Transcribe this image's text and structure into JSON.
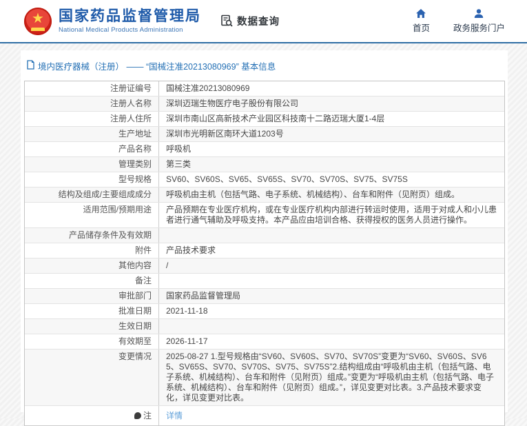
{
  "header": {
    "org_title_cn": "国家药品监督管理局",
    "org_title_en": "National Medical Products Administration",
    "data_query_label": "数据查询",
    "nav": {
      "home_label": "首页",
      "portal_label": "政务服务门户"
    }
  },
  "breadcrumb": {
    "text": "境内医疗器械（注册） —— “国械注准20213080969” 基本信息"
  },
  "colors": {
    "brand_blue": "#1e5aa9",
    "header_border_blue": "#2e6da4",
    "breadcrumb_blue": "#2470b5",
    "link_blue": "#5e9fd9",
    "row_stripe": "#f7f7f7"
  },
  "table": {
    "rows": [
      {
        "label": "注册证编号",
        "value": "国械注准20213080969"
      },
      {
        "label": "注册人名称",
        "value": "深圳迈瑞生物医疗电子股份有限公司"
      },
      {
        "label": "注册人住所",
        "value": "深圳市南山区高新技术产业园区科技南十二路迈瑞大厦1-4层"
      },
      {
        "label": "生产地址",
        "value": "深圳市光明新区南环大道1203号"
      },
      {
        "label": "产品名称",
        "value": "呼吸机"
      },
      {
        "label": "管理类别",
        "value": "第三类"
      },
      {
        "label": "型号规格",
        "value": "SV60、SV60S、SV65、SV65S、SV70、SV70S、SV75、SV75S"
      },
      {
        "label": "结构及组成/主要组成成分",
        "value": "呼吸机由主机（包括气路、电子系统、机械结构）、台车和附件（见附页）组成。"
      },
      {
        "label": "适用范围/预期用途",
        "value": "产品预期在专业医疗机构，或在专业医疗机构内部进行转运时使用，适用于对成人和小儿患者进行通气辅助及呼吸支持。本产品应由培训合格、获得授权的医务人员进行操作。"
      },
      {
        "label": "产品储存条件及有效期",
        "value": ""
      },
      {
        "label": "附件",
        "value": "产品技术要求"
      },
      {
        "label": "其他内容",
        "value": "/"
      },
      {
        "label": "备注",
        "value": ""
      },
      {
        "label": "审批部门",
        "value": "国家药品监督管理局"
      },
      {
        "label": "批准日期",
        "value": "2021-11-18"
      },
      {
        "label": "生效日期",
        "value": ""
      },
      {
        "label": "有效期至",
        "value": "2026-11-17"
      },
      {
        "label": "变更情况",
        "value": "2025-08-27 1.型号规格由“SV60、SV60S、SV70、SV70S”变更为“SV60、SV60S、SV65、SV65S、SV70、SV70S、SV75、SV75S”2.结构组成由“呼吸机由主机（包括气路、电子系统、机械结构）、台车和附件（见附页）组成。”变更为“呼吸机由主机（包括气路、电子系统、机械结构）、台车和附件（见附页）组成。”，详见变更对比表。3.产品技术要求变化，详见变更对比表。"
      },
      {
        "label": "注",
        "value": "详情",
        "link": true,
        "note_icon": true
      }
    ]
  }
}
